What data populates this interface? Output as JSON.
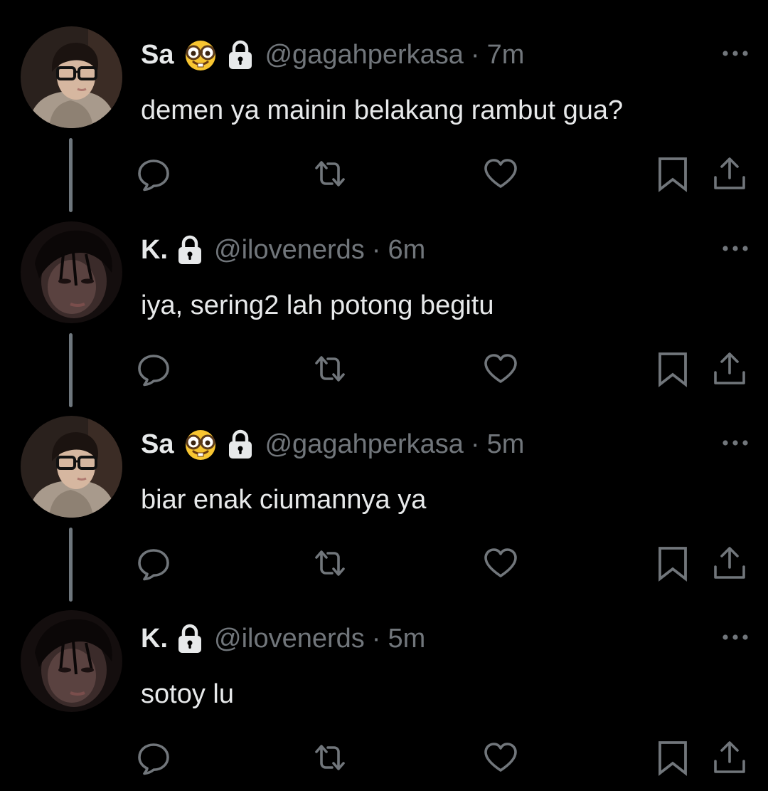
{
  "colors": {
    "background": "#000000",
    "text": "#e7e9ea",
    "secondary": "#71767b",
    "thread_line": "#6e767d"
  },
  "tweets": [
    {
      "name": "Sa",
      "emoji": "nerd-face-emoji",
      "protected": true,
      "handle": "@gagahperkasa",
      "separator": "·",
      "time": "7m",
      "text": "demen ya mainin belakang rambut gua?",
      "avatar": "sa-avatar"
    },
    {
      "name": "K.",
      "protected": true,
      "handle": "@ilovenerds",
      "separator": "·",
      "time": "6m",
      "text": "iya, sering2 lah potong begitu",
      "avatar": "k-avatar"
    },
    {
      "name": "Sa",
      "emoji": "nerd-face-emoji",
      "protected": true,
      "handle": "@gagahperkasa",
      "separator": "·",
      "time": "5m",
      "text": "biar enak ciumannya ya",
      "avatar": "sa-avatar"
    },
    {
      "name": "K.",
      "protected": true,
      "handle": "@ilovenerds",
      "separator": "·",
      "time": "5m",
      "text": "sotoy lu",
      "avatar": "k-avatar"
    }
  ],
  "icons": {
    "more": "more-horizontal-icon",
    "reply": "reply-icon",
    "retweet": "retweet-icon",
    "like": "heart-icon",
    "bookmark": "bookmark-icon",
    "share": "share-icon",
    "lock": "lock-icon"
  }
}
